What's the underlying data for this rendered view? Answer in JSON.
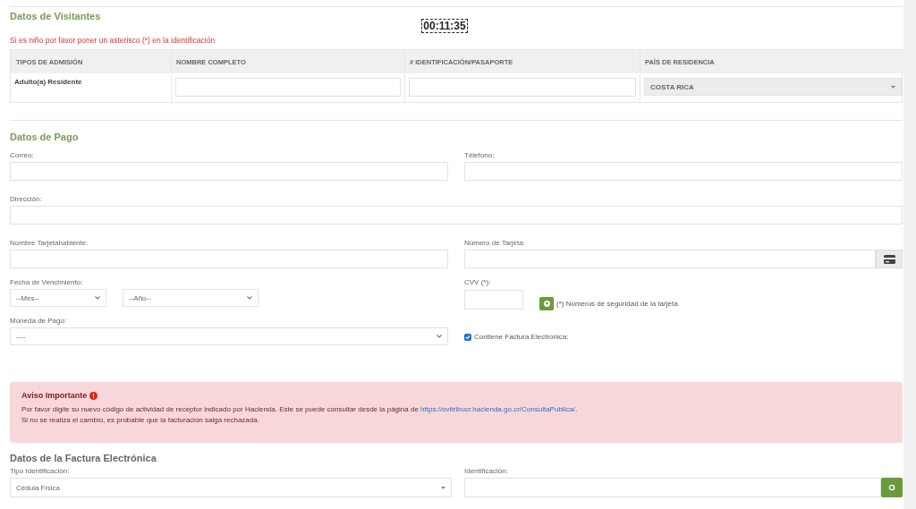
{
  "visitors": {
    "title": "Datos de Visitantes",
    "note": "Si es niño por favor poner un asterisco (*) en la identificación",
    "timer": "00:11:35",
    "columns": [
      "TIPOS DE ADMISIÓN",
      "NOMBRE COMPLETO",
      "# IDENTIFICACIÓN/PASAPORTE",
      "PAÍS DE RESIDENCIA"
    ],
    "rows": [
      {
        "type": "Adulto(a) Residente",
        "country": "COSTA RICA"
      }
    ]
  },
  "payment": {
    "title": "Datos de Pago",
    "email_label": "Correo:",
    "phone_label": "Télefono:",
    "address_label": "Dirección:",
    "cardholder_label": "Nombre Tarjetahabiente:",
    "card_number_label": "Número de Tarjeta:",
    "expiry_label": "Fecha de Vencimiento:",
    "month": "--Mes--",
    "year": "--Año--",
    "cvv_label": "CVV (*):",
    "cvv_help": "(*) Números de seguridad de la tarjeta",
    "currency_label": "Moneda de Pago:",
    "currency": "----",
    "invoice": {
      "label": "Contiene Factura Electronica:",
      "checked": true
    }
  },
  "alert": {
    "title": "Aviso Importante",
    "text": "Por favor digite su nuevo código de actividad de receptor indicado por Hacienda. Este se puede consultar desde la página de",
    "link": "https://ovitribucr.hacienda.go.cr/ConsultaPublica/",
    "link_after": ".",
    "text2": "Si no se realiza el cambio, es probable que la facturación salga rechazada."
  },
  "invoice_data": {
    "title": "Datos de la Factura Electrónica",
    "id_type_label": "Tipo Identificación:",
    "id_type": "Cédula Física",
    "id_label": "Identificación:"
  }
}
